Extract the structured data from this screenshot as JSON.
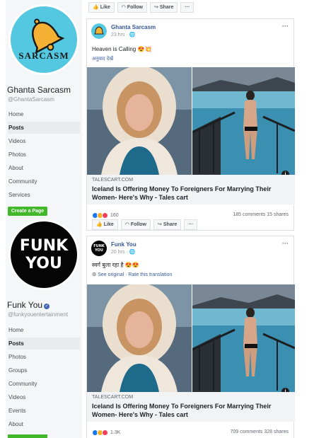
{
  "toolbar": {
    "like": "Like",
    "follow": "Follow",
    "share": "Share",
    "more": "···"
  },
  "page1": {
    "avatar_text": "SARCASM",
    "name": "Ghanta Sarcasm",
    "handle": "@GhantaSarcasm",
    "nav": [
      "Home",
      "Posts",
      "Videos",
      "Photos",
      "About",
      "Community",
      "Services"
    ],
    "active_nav": "Posts",
    "create_page": "Create a Page"
  },
  "page2": {
    "avatar_line1": "FUNK",
    "avatar_line2": "YOU",
    "name": "Funk You",
    "handle": "@funkyouentertainment",
    "nav": [
      "Home",
      "Posts",
      "Photos",
      "Groups",
      "Community",
      "Videos",
      "Events",
      "About"
    ],
    "active_nav": "Posts"
  },
  "post1": {
    "author": "Ghanta Sarcasm",
    "time": "23 hrs · 🌐",
    "text": "Heaven is Calling 😍💥",
    "see_translation": "अनुवाद देखें",
    "link_domain": "TALESCART.COM",
    "link_title": "Iceland Is Offering Money To Foreigners For Marrying Their Women- Here's Why - Tales cart",
    "reactions": "160",
    "comments_shares": "185 comments  15 shares"
  },
  "post2": {
    "author": "Funk You",
    "avatar_text": "FUNK YOU",
    "time": "20 hrs · 🌐",
    "text": "स्वर्ग बुला रहा है 😍😍",
    "see_original": "See original",
    "rate_translation": " · Rate this translation",
    "link_domain": "TALESCART.COM",
    "link_title": "Iceland Is Offering Money To Foreigners For Marrying Their Women- Here's Why - Tales cart",
    "reactions": "1.3K",
    "comments_shares": "709 comments  328 shares"
  },
  "colors": {
    "link_blue": "#365899",
    "create_green": "#42b72a",
    "sidebar_bg": "#f5f6f7",
    "sarcasm_bg": "#54c8e0",
    "bell": "#f5b133"
  }
}
